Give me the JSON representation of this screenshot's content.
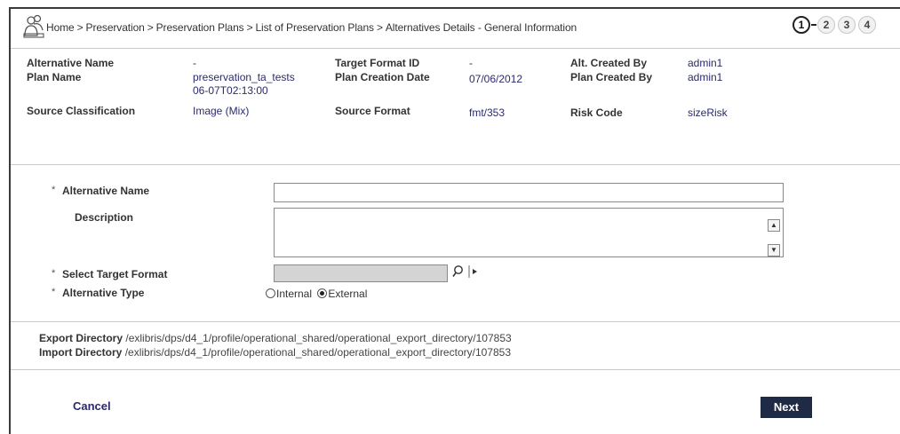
{
  "breadcrumb": {
    "items": [
      "Home",
      "Preservation",
      "Preservation Plans",
      "List of Preservation Plans",
      "Alternatives Details - General Information"
    ],
    "separator": ">"
  },
  "steps": [
    "1",
    "2",
    "3",
    "4"
  ],
  "active_step": "1",
  "info": {
    "alternative_name_label": "Alternative Name",
    "alternative_name_value": "-",
    "plan_name_label": "Plan Name",
    "plan_name_value_line1": "preservation_ta_tests",
    "plan_name_value_line2": "06-07T02:13:00",
    "source_classification_label": "Source Classification",
    "source_classification_value": "Image (Mix)",
    "target_format_id_label": "Target Format ID",
    "target_format_id_value": "-",
    "plan_creation_date_label": "Plan Creation Date",
    "plan_creation_date_value": "07/06/2012",
    "source_format_label": "Source Format",
    "source_format_value": "fmt/353",
    "alt_created_by_label": "Alt. Created By",
    "alt_created_by_value": "admin1",
    "plan_created_by_label": "Plan Created By",
    "plan_created_by_value": "admin1",
    "risk_code_label": "Risk Code",
    "risk_code_value": "sizeRisk"
  },
  "form": {
    "required_marker": "*",
    "alternative_name_label": "Alternative Name",
    "alternative_name_value": "",
    "description_label": "Description",
    "description_value": "",
    "select_target_format_label": "Select Target Format",
    "select_target_format_value": "",
    "alternative_type_label": "Alternative Type",
    "alternative_type_options": [
      "Internal",
      "External"
    ],
    "alternative_type_selected": "External"
  },
  "directories": {
    "export_label": "Export Directory",
    "export_value": "/exlibris/dps/d4_1/profile/operational_shared/operational_export_directory/107853",
    "import_label": "Import Directory",
    "import_value": "/exlibris/dps/d4_1/profile/operational_shared/operational_export_directory/107853"
  },
  "actions": {
    "cancel_label": "Cancel",
    "next_label": "Next"
  },
  "icons": {
    "header": "people-icon",
    "lookup": "magnifier-icon",
    "lookup_expand": "play-arrow-icon",
    "scroll_up": "triangle-up-icon",
    "scroll_down": "triangle-down-icon"
  },
  "colors": {
    "link": "#2a2a6e",
    "next_button": "#1f2a44",
    "frame": "#3a3a3a"
  }
}
